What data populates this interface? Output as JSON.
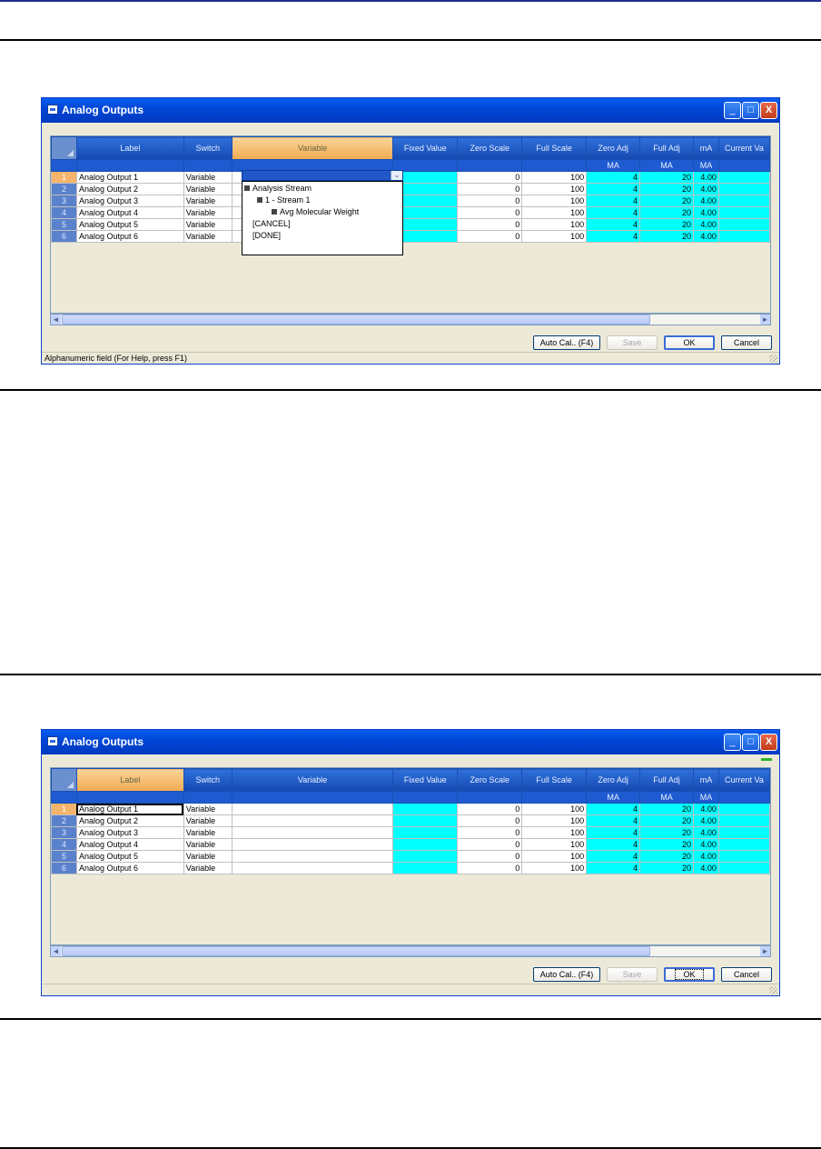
{
  "window": {
    "title": "Analog Outputs",
    "minimize_glyph": "_",
    "maximize_glyph": "□",
    "close_glyph": "X"
  },
  "grid": {
    "headers": [
      "Label",
      "Switch",
      "Variable",
      "Fixed Value",
      "Zero Scale",
      "Full Scale",
      "Zero Adj",
      "Full Adj",
      "mA",
      "Current Va"
    ],
    "units": [
      "",
      "",
      "",
      "",
      "",
      "",
      "MA",
      "MA",
      "MA",
      ""
    ],
    "rows": [
      {
        "num": "1",
        "label": "Analog Output 1",
        "switch": "Variable",
        "zero_scale": "0",
        "full_scale": "100",
        "zero_adj": "4",
        "full_adj": "20",
        "ma": "4.00"
      },
      {
        "num": "2",
        "label": "Analog Output 2",
        "switch": "Variable",
        "zero_scale": "0",
        "full_scale": "100",
        "zero_adj": "4",
        "full_adj": "20",
        "ma": "4.00"
      },
      {
        "num": "3",
        "label": "Analog Output 3",
        "switch": "Variable",
        "zero_scale": "0",
        "full_scale": "100",
        "zero_adj": "4",
        "full_adj": "20",
        "ma": "4.00"
      },
      {
        "num": "4",
        "label": "Analog Output 4",
        "switch": "Variable",
        "zero_scale": "0",
        "full_scale": "100",
        "zero_adj": "4",
        "full_adj": "20",
        "ma": "4.00"
      },
      {
        "num": "5",
        "label": "Analog Output 5",
        "switch": "Variable",
        "zero_scale": "0",
        "full_scale": "100",
        "zero_adj": "4",
        "full_adj": "20",
        "ma": "4.00"
      },
      {
        "num": "6",
        "label": "Analog Output 6",
        "switch": "Variable",
        "zero_scale": "0",
        "full_scale": "100",
        "zero_adj": "4",
        "full_adj": "20",
        "ma": "4.00"
      }
    ]
  },
  "dropdown": {
    "arrow_glyph": "⌄",
    "tree": [
      {
        "label": "Analysis Stream",
        "depth": 0,
        "toggle": true
      },
      {
        "label": "1 - Stream 1",
        "depth": 1,
        "toggle": true
      },
      {
        "label": "Avg Molecular Weight",
        "depth": 2,
        "toggle": true
      },
      {
        "label": "[CANCEL]",
        "depth": 0,
        "toggle": false
      },
      {
        "label": "[DONE]",
        "depth": 0,
        "toggle": false
      }
    ]
  },
  "buttons": {
    "auto_cal": "Auto Cal.. (F4)",
    "save": "Save",
    "ok": "OK",
    "cancel": "Cancel"
  },
  "status_text": "Alphanumeric field (For Help, press F1)",
  "scrollbar": {
    "left_glyph": "◄",
    "right_glyph": "►"
  },
  "colors": {
    "title_bar": "#0047d6",
    "header_blue": "#1f5bd0",
    "selected_header": "#f0aa52",
    "cyan_cells": "#00ffff"
  }
}
